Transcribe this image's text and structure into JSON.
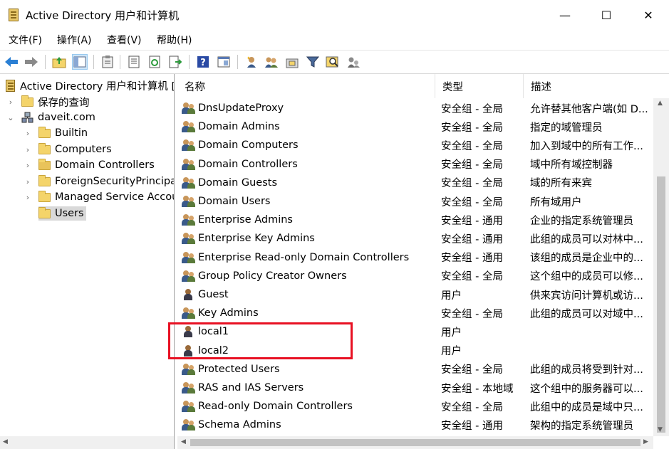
{
  "window": {
    "title": "Active Directory 用户和计算机",
    "minimize_glyph": "—",
    "maximize_glyph": "☐",
    "close_glyph": "✕"
  },
  "menu": [
    "文件(F)",
    "操作(A)",
    "查看(V)",
    "帮助(H)"
  ],
  "tree": {
    "root": "Active Directory 用户和计算机 [",
    "saved_queries": "保存的查询",
    "domain": "daveit.com",
    "children": [
      "Builtin",
      "Computers",
      "Domain Controllers",
      "ForeignSecurityPrincipal",
      "Managed Service Accou",
      "Users"
    ]
  },
  "columns": {
    "name": "名称",
    "type": "类型",
    "description": "描述"
  },
  "rows": [
    {
      "name": "DnsUpdateProxy",
      "type": "安全组 - 全局",
      "description": "允许替其他客户端(如 D...",
      "icon": "group-icon"
    },
    {
      "name": "Domain Admins",
      "type": "安全组 - 全局",
      "description": "指定的域管理员",
      "icon": "group-icon"
    },
    {
      "name": "Domain Computers",
      "type": "安全组 - 全局",
      "description": "加入到域中的所有工作...",
      "icon": "group-icon"
    },
    {
      "name": "Domain Controllers",
      "type": "安全组 - 全局",
      "description": "域中所有域控制器",
      "icon": "group-icon"
    },
    {
      "name": "Domain Guests",
      "type": "安全组 - 全局",
      "description": "域的所有来宾",
      "icon": "group-icon"
    },
    {
      "name": "Domain Users",
      "type": "安全组 - 全局",
      "description": "所有域用户",
      "icon": "group-icon"
    },
    {
      "name": "Enterprise Admins",
      "type": "安全组 - 通用",
      "description": "企业的指定系统管理员",
      "icon": "group-icon"
    },
    {
      "name": "Enterprise Key Admins",
      "type": "安全组 - 通用",
      "description": "此组的成员可以对林中...",
      "icon": "group-icon"
    },
    {
      "name": "Enterprise Read-only Domain Controllers",
      "type": "安全组 - 通用",
      "description": "该组的成员是企业中的...",
      "icon": "group-icon"
    },
    {
      "name": "Group Policy Creator Owners",
      "type": "安全组 - 全局",
      "description": "这个组中的成员可以修...",
      "icon": "group-icon"
    },
    {
      "name": "Guest",
      "type": "用户",
      "description": "供来宾访问计算机或访...",
      "icon": "user-icon"
    },
    {
      "name": "Key Admins",
      "type": "安全组 - 全局",
      "description": "此组的成员可以对域中...",
      "icon": "group-icon"
    },
    {
      "name": "local1",
      "type": "用户",
      "description": "",
      "icon": "user-icon"
    },
    {
      "name": "local2",
      "type": "用户",
      "description": "",
      "icon": "user-icon"
    },
    {
      "name": "Protected Users",
      "type": "安全组 - 全局",
      "description": "此组的成员将受到针对...",
      "icon": "group-icon"
    },
    {
      "name": "RAS and IAS Servers",
      "type": "安全组 - 本地域",
      "description": "这个组中的服务器可以...",
      "icon": "group-icon"
    },
    {
      "name": "Read-only Domain Controllers",
      "type": "安全组 - 全局",
      "description": "此组中的成员是域中只...",
      "icon": "group-icon"
    },
    {
      "name": "Schema Admins",
      "type": "安全组 - 通用",
      "description": "架构的指定系统管理员",
      "icon": "group-icon"
    }
  ],
  "colors": {
    "highlight_box": "#e81123",
    "selection": "#d9d9d9"
  }
}
